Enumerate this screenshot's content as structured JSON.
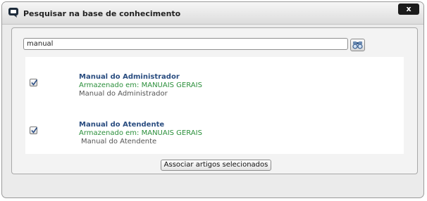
{
  "dialog": {
    "title": "Pesquisar na base de conhecimento",
    "close_label": "x"
  },
  "search": {
    "value": "manual"
  },
  "results": [
    {
      "checked": true,
      "title": "Manual do Administrador",
      "stored_in": "Armazenado em: MANUAIS GERAIS",
      "description": "Manual do Administrador"
    },
    {
      "checked": true,
      "title": "Manual do Atendente",
      "stored_in": "Armazenado em: MANUAIS GERAIS",
      "description": "Manual do Atendente"
    }
  ],
  "actions": {
    "associate_label": "Associar artigos selecionados"
  },
  "colors": {
    "title_link": "#2a4d80",
    "stored_in": "#2b8f3b",
    "close_button": "#1a1a1a"
  }
}
